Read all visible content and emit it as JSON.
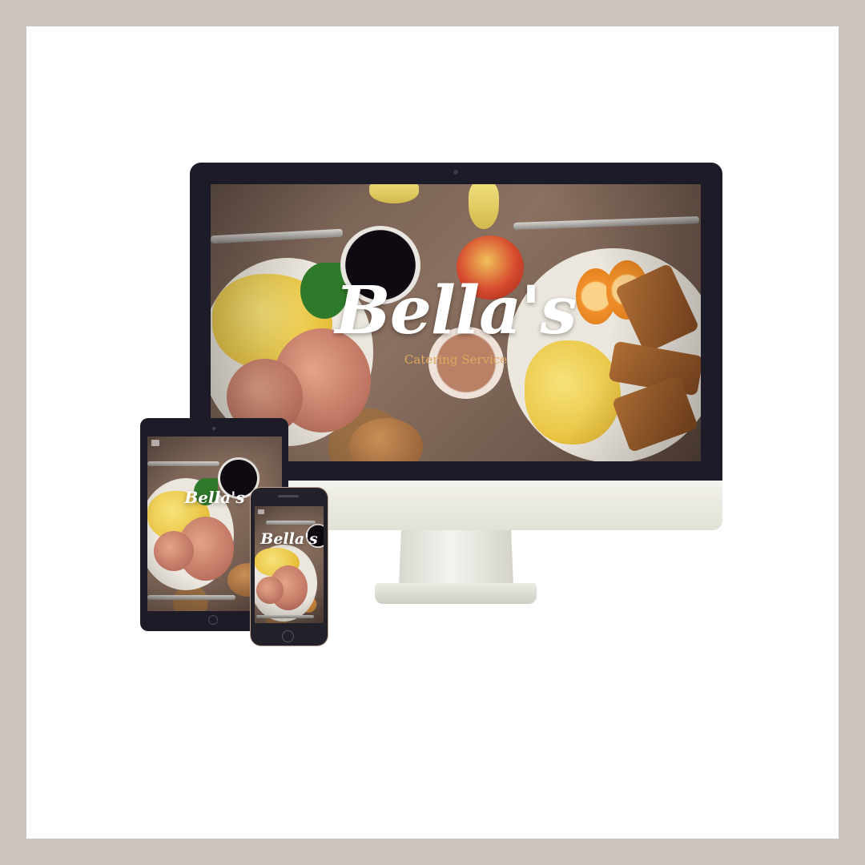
{
  "brand": {
    "name": "Bella's",
    "tagline": "Catering Service"
  },
  "devices": {
    "desktop": {
      "logo_icon": "apple-logo-icon",
      "logo_glyph": ""
    },
    "tablet": {
      "menu_icon": "hamburger-menu-icon"
    },
    "phone": {
      "menu_icon": "hamburger-menu-icon"
    }
  },
  "colors": {
    "frame": "#cbc4bf",
    "bezel": "#1c1b27",
    "tagline": "#e0a75d"
  }
}
